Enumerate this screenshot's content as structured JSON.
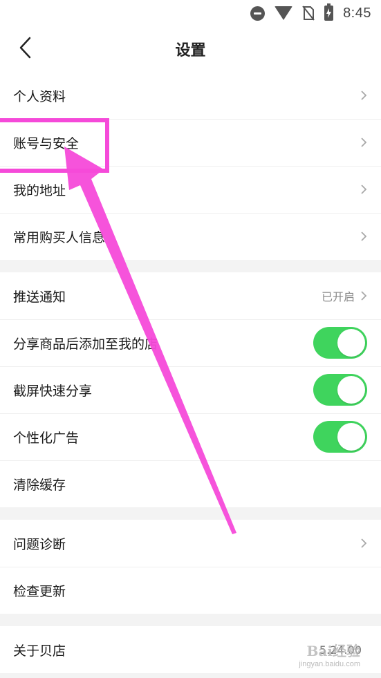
{
  "status_bar": {
    "time": "8:45",
    "icons": [
      "do-not-disturb-icon",
      "wifi-icon",
      "no-sim-icon",
      "battery-charging-icon"
    ]
  },
  "header": {
    "title": "设置",
    "back_icon": "chevron-left-icon"
  },
  "sections": {
    "account": [
      {
        "label": "个人资料"
      },
      {
        "label": "账号与安全"
      },
      {
        "label": "我的地址"
      },
      {
        "label": "常用购买人信息"
      }
    ],
    "notifications": {
      "push": {
        "label": "推送通知",
        "value": "已开启"
      },
      "share_add": {
        "label": "分享商品后添加至我的店",
        "enabled": true
      },
      "screenshot_share": {
        "label": "截屏快速分享",
        "enabled": true
      },
      "personalized_ads": {
        "label": "个性化广告",
        "enabled": true
      },
      "clear_cache": {
        "label": "清除缓存"
      }
    },
    "support": [
      {
        "label": "问题诊断"
      },
      {
        "label": "检查更新"
      }
    ],
    "about": {
      "label": "关于贝店",
      "value": "5.24.00"
    }
  },
  "overlay": {
    "highlight_color": "#f54ad9",
    "highlighted_item": "账号与安全"
  },
  "watermark": {
    "main": "Bai经验",
    "sub": "jingyan.baidu.com"
  },
  "colors": {
    "toggle_on": "#3fd45d",
    "section_gap": "#f3f3f3"
  }
}
